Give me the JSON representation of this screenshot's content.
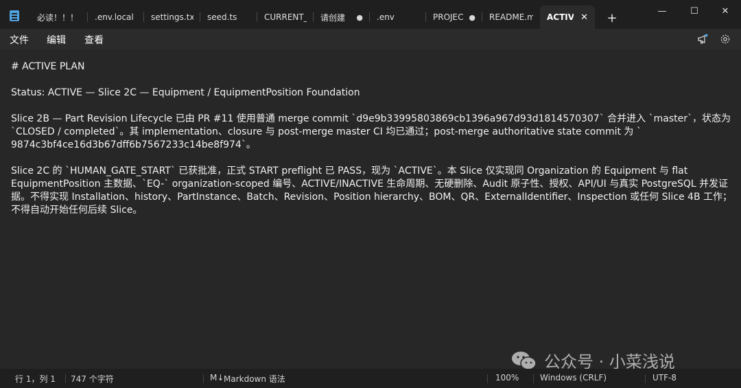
{
  "window": {
    "tabs": [
      {
        "label": "必读！！！",
        "dirty": false
      },
      {
        "label": ".env.local",
        "dirty": false
      },
      {
        "label": "settings.txt",
        "dirty": false
      },
      {
        "label": "seed.ts",
        "dirty": false
      },
      {
        "label": "CURRENT_STA",
        "dirty": false
      },
      {
        "label": "请创建",
        "dirty": true
      },
      {
        "label": ".env",
        "dirty": false
      },
      {
        "label": "PROJEC",
        "dirty": true
      },
      {
        "label": "README.md",
        "dirty": false
      },
      {
        "label": "ACTIV",
        "dirty": false,
        "active": true
      }
    ],
    "new_tab": "+",
    "minimize": "—",
    "maximize": "☐",
    "close": "✕",
    "tab_close": "✕",
    "dirty_dot": "●"
  },
  "menu": {
    "file": "文件",
    "edit": "编辑",
    "view": "查看"
  },
  "editor": {
    "lines": [
      "# ACTIVE PLAN",
      "",
      "Status: ACTIVE — Slice 2C — Equipment / EquipmentPosition Foundation",
      "",
      "Slice 2B — Part Revision Lifecycle 已由 PR #11 使用普通 merge commit `d9e9b33995803869cb1396a967d93d1814570307` 合并进入 `master`，状态为",
      "`CLOSED / completed`。其 implementation、closure 与 post-merge master CI 均已通过；post-merge authoritative state commit 为 `",
      "9874c3bf4ce16d3b67dff6b7567233c14be8f974`。",
      "",
      "Slice 2C 的 `HUMAN_GATE_START` 已获批准，正式 START preflight 已 PASS，现为 `ACTIVE`。本 Slice 仅实现同 Organization 的 Equipment 与 flat",
      "EquipmentPosition 主数据、`EQ-` organization-scoped 编号、ACTIVE/INACTIVE 生命周期、无硬删除、Audit 原子性、授权、API/UI 与真实 PostgreSQL 并发证",
      "据。不得实现 Installation、history、PartInstance、Batch、Revision、Position hierarchy、BOM、QR、ExternalIdentifier、Inspection 或任何 Slice 4B 工作；",
      "不得自动开始任何后续 Slice。"
    ]
  },
  "watermark": {
    "text": "公众号 · 小菜浅说"
  },
  "status": {
    "position": "行 1，列 1",
    "chars": "747 个字符",
    "mode_icon": "M↓",
    "mode": "Markdown 语法",
    "zoom": "100%",
    "line_ending": "Windows (CRLF)",
    "encoding": "UTF-8"
  }
}
